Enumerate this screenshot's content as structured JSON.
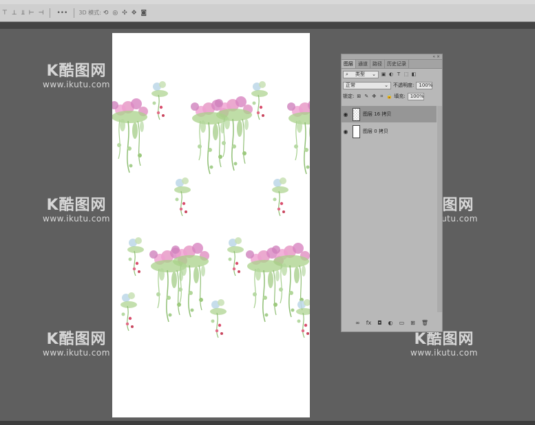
{
  "options_bar": {
    "mode_3d_label": "3D 模式:",
    "more_label": "•••"
  },
  "watermark": {
    "logo": "K酷图网",
    "url": "www.ikutu.com"
  },
  "layers_panel": {
    "tabs": [
      "图层",
      "通道",
      "路径",
      "历史记录"
    ],
    "filter_label": "类型",
    "blend_mode": "正常",
    "opacity_label": "不透明度:",
    "opacity_value": "100%",
    "lock_label": "锁定:",
    "fill_label": "填充:",
    "fill_value": "100%",
    "layers": [
      {
        "name": "图层 16 拷贝",
        "selected": true
      },
      {
        "name": "图层 0 拷贝",
        "selected": false
      }
    ],
    "footer_icons": [
      "link-icon",
      "fx-icon",
      "mask-icon",
      "adjustment-icon",
      "folder-icon",
      "new-layer-icon",
      "trash-icon"
    ],
    "footer_glyphs": [
      "∞",
      "fx",
      "◘",
      "◐",
      "▭",
      "⊞",
      "🗑"
    ]
  },
  "colors": {
    "workspace": "#5f5f5f",
    "panel_bg": "#b8b8b8",
    "selected_layer": "#969696",
    "flower_pink": "#e08fc0",
    "leaf_green": "#9cc97d"
  }
}
